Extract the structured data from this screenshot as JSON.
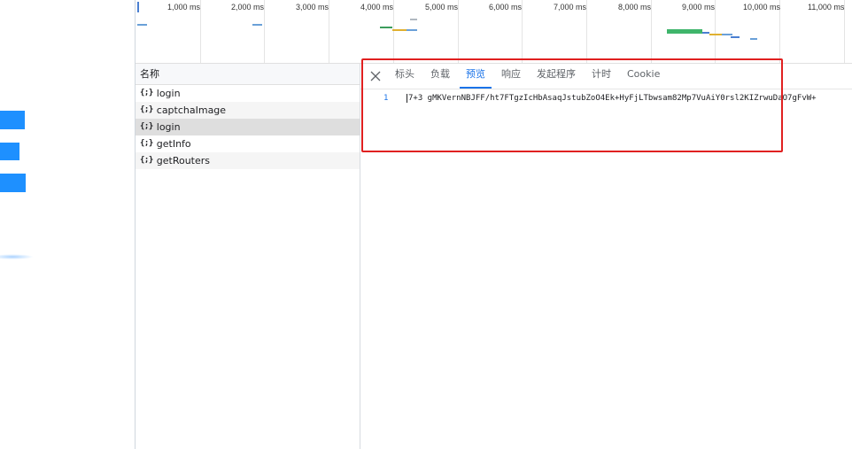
{
  "overview": {
    "ticks": [
      "1,000 ms",
      "2,000 ms",
      "3,000 ms",
      "4,000 ms",
      "5,000 ms",
      "6,000 ms",
      "7,000 ms",
      "8,000 ms",
      "9,000 ms",
      "10,000 ms",
      "11,000 ms"
    ]
  },
  "name_column": {
    "header": "名称",
    "requests": [
      {
        "icon": "{;}",
        "name": "login"
      },
      {
        "icon": "{;}",
        "name": "captchaImage"
      },
      {
        "icon": "{;}",
        "name": "login"
      },
      {
        "icon": "{;}",
        "name": "getInfo"
      },
      {
        "icon": "{;}",
        "name": "getRouters"
      }
    ]
  },
  "detail": {
    "close_icon": "close-icon",
    "tabs": [
      "标头",
      "负载",
      "预览",
      "响应",
      "发起程序",
      "计时",
      "Cookie"
    ],
    "active_tab": "预览",
    "preview": {
      "line_number": "1",
      "content": "7+3 gMKVernNBJFF/ht7FTgzIcHbAsaqJstubZoO4Ek+HyFjLTbwsam82Mp7VuAiY0rsl2KIZrwuDaO7gFvW+"
    }
  },
  "colors": {
    "accent": "#1a73e8",
    "highlight_border": "#e02020",
    "selected_row": "#dedede",
    "page_blue": "#1e90ff"
  }
}
